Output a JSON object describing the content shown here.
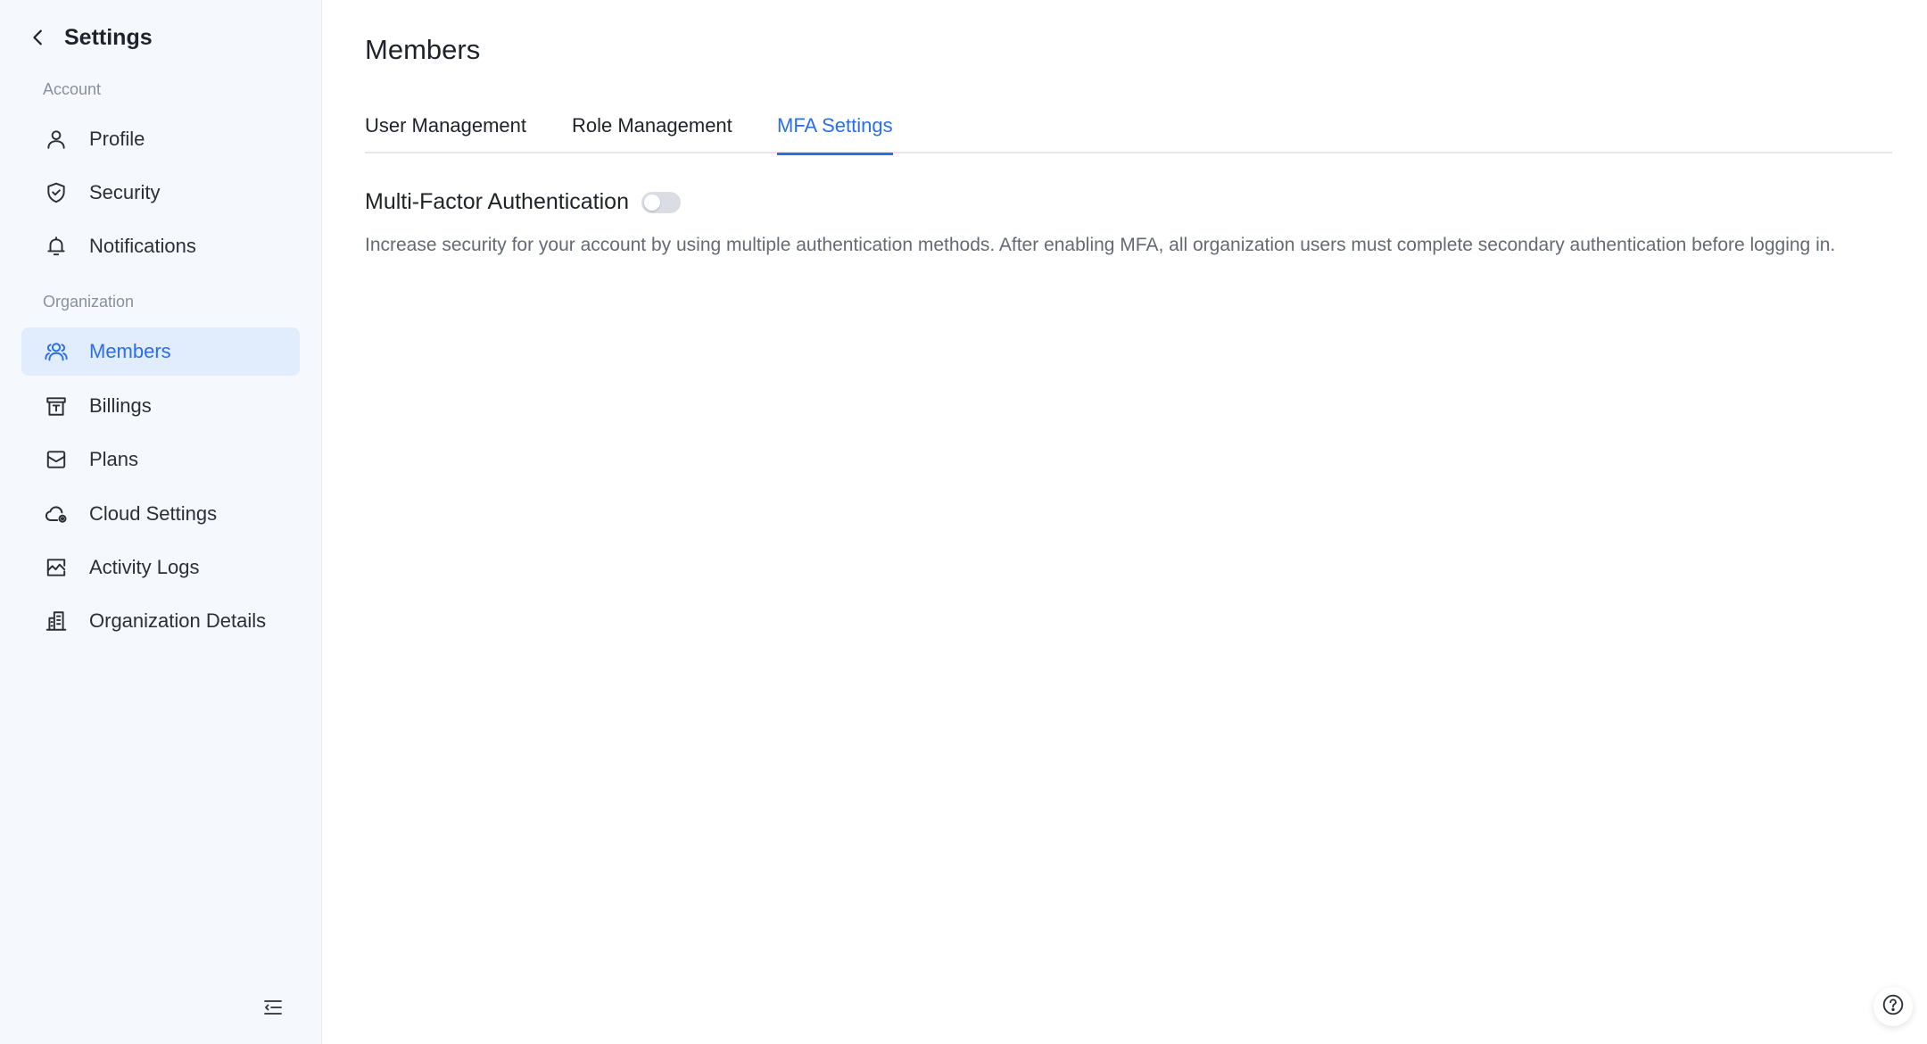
{
  "sidebar": {
    "title": "Settings",
    "sections": {
      "account": "Account",
      "organization": "Organization"
    },
    "items": [
      {
        "label": "Profile",
        "icon": "user-icon"
      },
      {
        "label": "Security",
        "icon": "shield-icon"
      },
      {
        "label": "Notifications",
        "icon": "bell-icon"
      },
      {
        "label": "Members",
        "icon": "members-icon",
        "active": true
      },
      {
        "label": "Billings",
        "icon": "billing-icon"
      },
      {
        "label": "Plans",
        "icon": "plans-icon"
      },
      {
        "label": "Cloud Settings",
        "icon": "cloud-settings-icon"
      },
      {
        "label": "Activity Logs",
        "icon": "activity-icon"
      },
      {
        "label": "Organization Details",
        "icon": "building-icon"
      }
    ]
  },
  "main": {
    "title": "Members",
    "tabs": [
      {
        "label": "User Management"
      },
      {
        "label": "Role Management"
      },
      {
        "label": "MFA Settings",
        "active": true
      }
    ],
    "mfa": {
      "title": "Multi-Factor Authentication",
      "enabled": false,
      "description": "Increase security for your account by using multiple authentication methods. After enabling MFA, all organization users must complete secondary authentication before logging in."
    }
  },
  "colors": {
    "accent": "#2a6fe8",
    "sidebar_bg": "#f5f8fd",
    "active_bg": "#e1ecfd",
    "toggle_off": "#dadde3"
  }
}
